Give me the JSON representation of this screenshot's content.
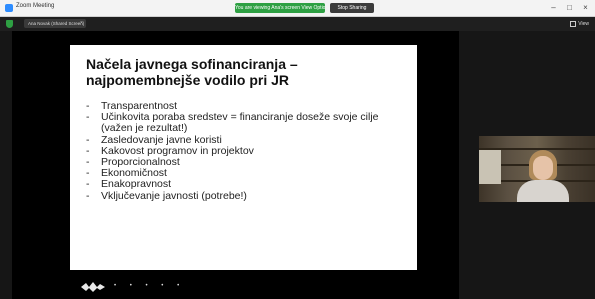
{
  "window": {
    "app_title": "Zoom Meeting",
    "share_banner": "You are viewing Ana's screen  View Options",
    "stop_label": "Stop Sharing",
    "minimize": "–",
    "maximize": "□",
    "close": "×"
  },
  "toolbar": {
    "tab_label": "Ana Novak (Shared Screen)",
    "tab_close": "×",
    "view_label": "View"
  },
  "slide": {
    "title": "Načela javnega sofinanciranja – najpomembnejše vodilo pri JR",
    "bullets": [
      "Transparentnost",
      "Učinkovita poraba sredstev = financiranje doseže svoje cilje (važen je rezultat!)",
      "Zasledovanje javne koristi",
      "Kakovost programov in projektov",
      "Proporcionalnost",
      "Ekonomičnost",
      "Enakopravnost",
      "Vključevanje javnosti (potrebe!)"
    ]
  },
  "footer": {
    "logo_dots": "• • • • •"
  },
  "colors": {
    "share_green": "#2ea043",
    "stage_bg": "#161616",
    "slide_bg": "#ffffff"
  },
  "icons": {
    "app": "zoom-app-icon",
    "security": "shield-icon",
    "view": "grid-view-icon"
  }
}
